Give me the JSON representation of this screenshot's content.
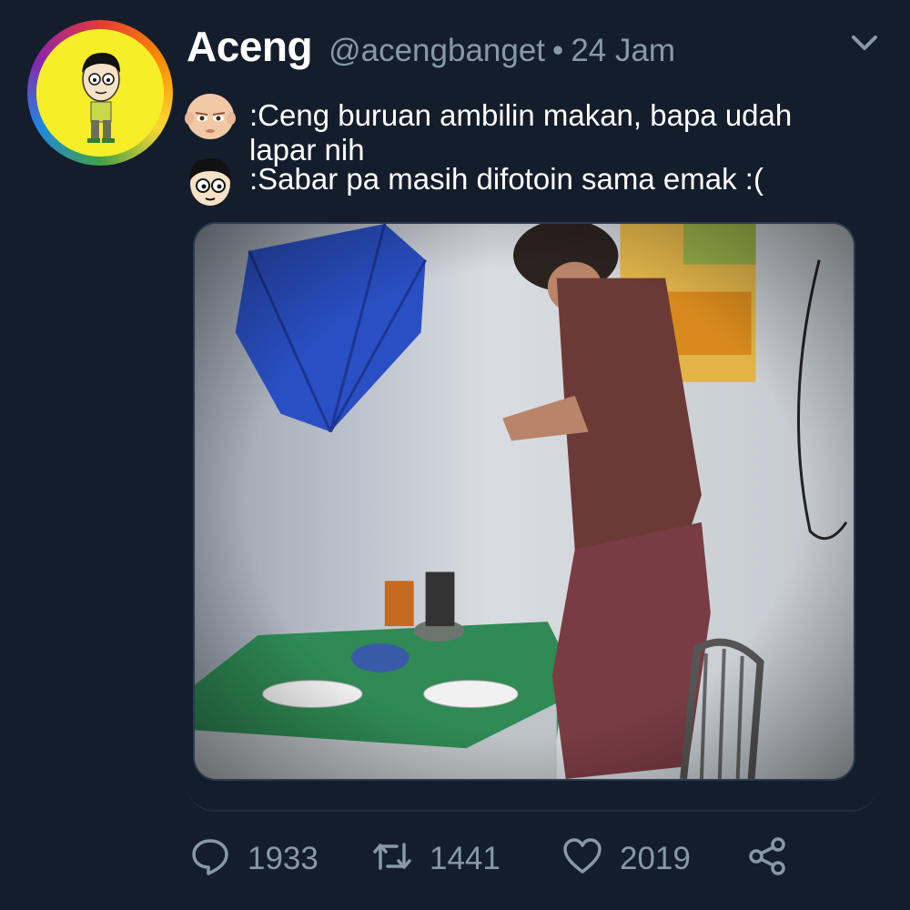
{
  "user": {
    "display_name": "Aceng",
    "handle": "@acengbanget",
    "separator": "•",
    "time": "24 Jam"
  },
  "dialog": [
    {
      "icon": "boss-baby-icon",
      "text": ":Ceng buruan ambilin makan, bapa udah lapar nih"
    },
    {
      "icon": "aceng-face-icon",
      "text": ":Sabar pa masih difotoin sama emak :("
    }
  ],
  "actions": {
    "reply_count": "1933",
    "retweet_count": "1441",
    "like_count": "2019"
  },
  "colors": {
    "background": "#141d2b",
    "muted_text": "#8899a6",
    "text": "#ffffff"
  }
}
